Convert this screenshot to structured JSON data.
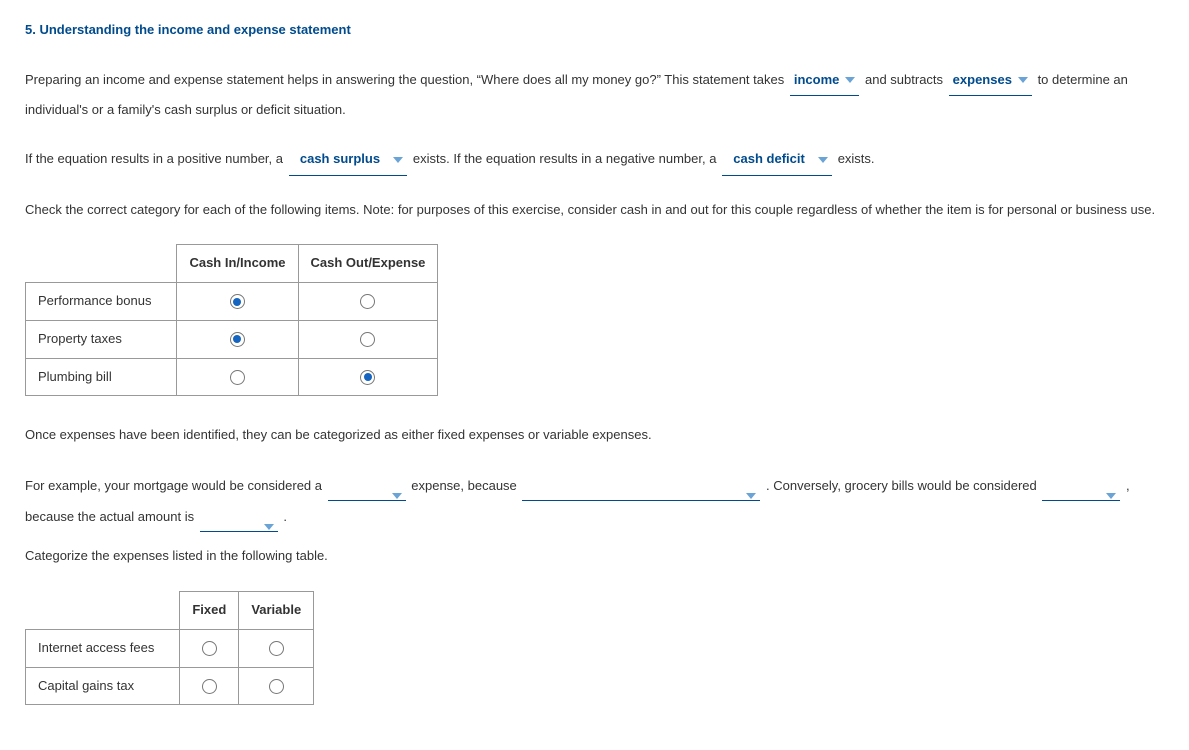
{
  "heading": "5. Understanding the income and expense statement",
  "p1_a": "Preparing an income and expense statement helps in answering the question, “Where does all my money go?” This statement takes",
  "dd_income": "income",
  "p1_b": "and subtracts",
  "dd_expenses": "expenses",
  "p1_c": "to determine an individual's or a family's cash surplus or deficit situation.",
  "p2_a": "If the equation results in a positive number, a",
  "dd_surplus": "cash surplus",
  "p2_b": "exists. If the equation results in a negative number, a",
  "dd_deficit": "cash deficit",
  "p2_c": "exists.",
  "p3": "Check the correct category for each of the following items. Note: for purposes of this exercise, consider cash in and out for this couple regardless of whether the item is for personal or business use.",
  "table1": {
    "col1": "Cash In/Income",
    "col2": "Cash Out/Expense",
    "rows": [
      {
        "label": "Performance bonus",
        "sel": 0
      },
      {
        "label": "Property taxes",
        "sel": 0
      },
      {
        "label": "Plumbing bill",
        "sel": 1
      }
    ]
  },
  "p4": "Once expenses have been identified, they can be categorized as either fixed expenses or variable expenses.",
  "p5_a": "For example, your mortgage would be considered a",
  "p5_b": "expense, because",
  "p5_c": ". Conversely, grocery bills would be considered",
  "p5_d": ", because the actual amount is",
  "p5_e": ".",
  "p6": "Categorize the expenses listed in the following table.",
  "table2": {
    "col1": "Fixed",
    "col2": "Variable",
    "rows": [
      {
        "label": "Internet access fees",
        "sel": -1
      },
      {
        "label": "Capital gains tax",
        "sel": -1
      }
    ]
  }
}
